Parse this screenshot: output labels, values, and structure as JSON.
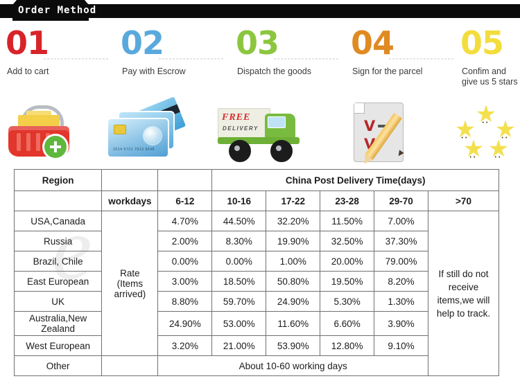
{
  "banner": {
    "title": "Order Method"
  },
  "steps": [
    {
      "num": "01",
      "label": "Add to cart",
      "color": "#d8232a",
      "icon": "shopping-basket-icon"
    },
    {
      "num": "02",
      "label": "Pay with Escrow",
      "color": "#5aa9dd",
      "icon": "credit-card-icon"
    },
    {
      "num": "03",
      "label": "Dispatch the goods",
      "color": "#8cc63f",
      "icon": "delivery-truck-icon"
    },
    {
      "num": "04",
      "label": "Sign for the parcel",
      "color": "#e08a22",
      "icon": "signed-document-icon"
    },
    {
      "num": "05",
      "label": "Confim and give us 5 stars",
      "color": "#f2dd3d",
      "icon": "five-stars-icon"
    }
  ],
  "truck_icon": {
    "line1": "FREE",
    "line2": "DELIVERY"
  },
  "card_icon": {
    "number": "2014  5721  7913  9648"
  },
  "table": {
    "header": {
      "region": "Region",
      "title": "China Post  Delivery Time(days)"
    },
    "subheader": {
      "workdays": "workdays",
      "ranges": [
        "6-12",
        "10-16",
        "17-22",
        "23-28",
        "29-70",
        ">70"
      ]
    },
    "rate_label": "Rate (Items arrived)",
    "rate_label_lines": [
      "Rate",
      "(Items",
      "arrived)"
    ],
    "note": "If still do not receive items,we will help to track.",
    "rows": [
      {
        "region": "USA,Canada",
        "values": [
          "4.70%",
          "44.50%",
          "32.20%",
          "11.50%",
          "7.00%"
        ]
      },
      {
        "region": "Russia",
        "values": [
          "2.00%",
          "8.30%",
          "19.90%",
          "32.50%",
          "37.30%"
        ]
      },
      {
        "region": "Brazil, Chile",
        "values": [
          "0.00%",
          "0.00%",
          "1.00%",
          "20.00%",
          "79.00%"
        ]
      },
      {
        "region": "East European",
        "values": [
          "3.00%",
          "18.50%",
          "50.80%",
          "19.50%",
          "8.20%"
        ]
      },
      {
        "region": "UK",
        "values": [
          "8.80%",
          "59.70%",
          "24.90%",
          "5.30%",
          "1.30%"
        ]
      },
      {
        "region": "Australia,New Zealand",
        "values": [
          "24.90%",
          "53.00%",
          "11.60%",
          "6.60%",
          "3.90%"
        ]
      },
      {
        "region": "West European",
        "values": [
          "3.20%",
          "21.00%",
          "53.90%",
          "12.80%",
          "9.10%"
        ]
      }
    ],
    "other_row": {
      "region": "Other",
      "text": "About 10-60 working days"
    }
  }
}
